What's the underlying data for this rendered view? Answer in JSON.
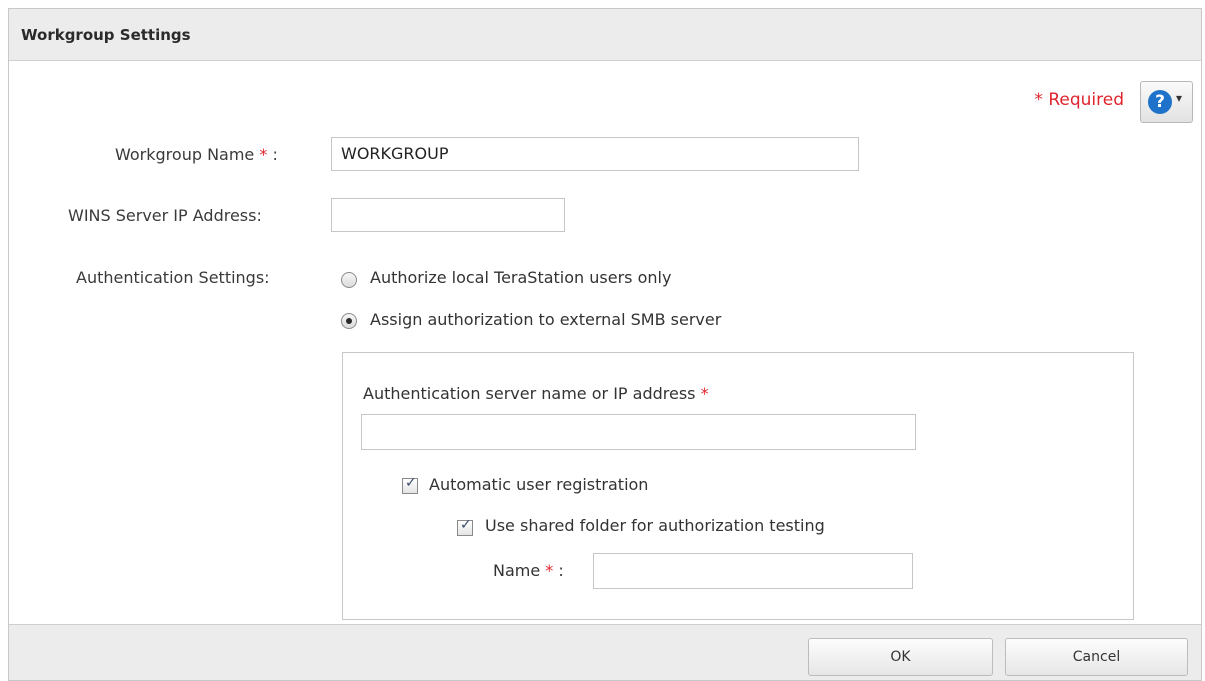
{
  "dialog": {
    "title": "Workgroup Settings"
  },
  "header": {
    "required_star": "*",
    "required_label": "Required",
    "help_glyph": "?",
    "help_caret": "▾"
  },
  "form": {
    "workgroup_name_label": "Workgroup Name",
    "workgroup_name_value": "WORKGROUP",
    "wins_label": "WINS Server IP Address:",
    "wins_value": "",
    "auth_label": "Authentication Settings:",
    "auth_options": [
      {
        "label": "Authorize local TeraStation users only",
        "selected": false
      },
      {
        "label": "Assign authorization to external SMB server",
        "selected": true
      }
    ]
  },
  "external": {
    "server_label": "Authentication server name or IP address",
    "server_value": "",
    "auto_register_label": "Automatic user registration",
    "auto_register_checked": true,
    "shared_folder_label": "Use shared folder for authorization testing",
    "shared_folder_checked": true,
    "name_label": "Name",
    "name_value": ""
  },
  "footer": {
    "ok_label": "OK",
    "cancel_label": "Cancel"
  },
  "colors": {
    "required": "#e0242e",
    "help_icon": "#1f72c9",
    "titlebar": "#ececec"
  },
  "icons": {
    "help": "question-circle-icon",
    "dropdown": "chevron-down-icon",
    "check": "checkmark-icon"
  }
}
